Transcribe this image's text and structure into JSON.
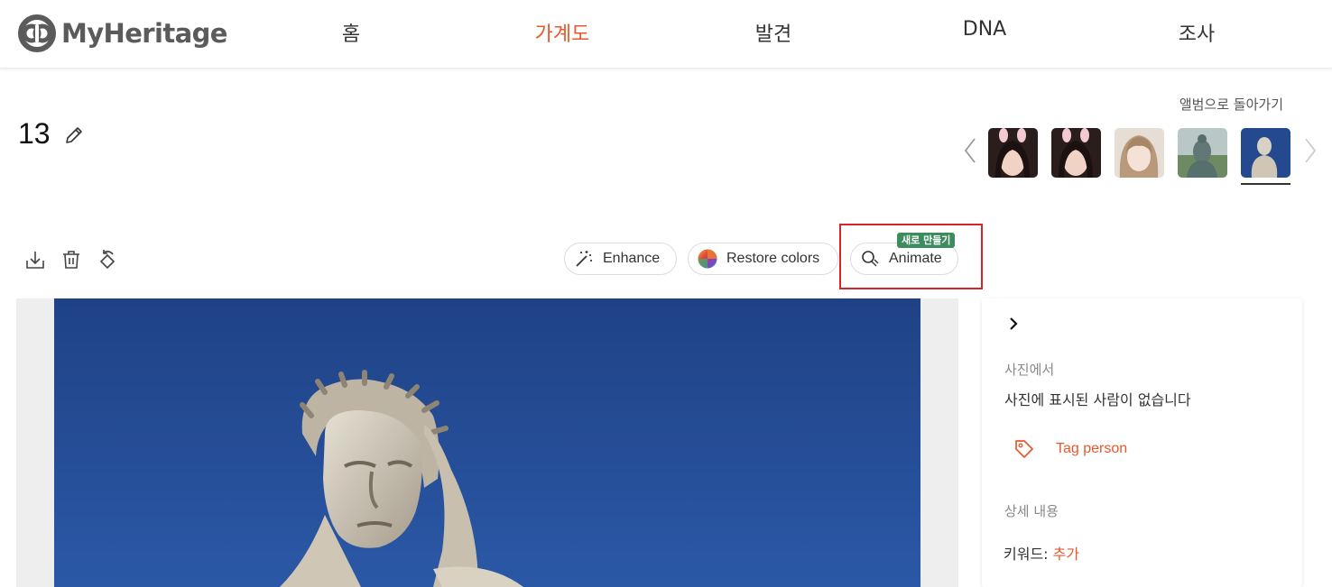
{
  "header": {
    "logo_text": "MyHeritage",
    "nav": [
      {
        "label": "홈",
        "active": false
      },
      {
        "label": "가계도",
        "active": true
      },
      {
        "label": "발견",
        "active": false
      },
      {
        "label": "DNA",
        "active": false
      },
      {
        "label": "조사",
        "active": false
      }
    ]
  },
  "album": {
    "back_label": "앨범으로 돌아가기",
    "thumbnails": [
      {
        "name": "thumb-photo-1",
        "selected": false
      },
      {
        "name": "thumb-photo-2",
        "selected": false
      },
      {
        "name": "thumb-photo-3",
        "selected": false
      },
      {
        "name": "thumb-photo-4",
        "selected": false
      },
      {
        "name": "thumb-photo-5",
        "selected": true
      }
    ]
  },
  "photo": {
    "title": "13"
  },
  "toolbar": {
    "icons": [
      "download-icon",
      "trash-icon",
      "rotate-icon"
    ],
    "enhance_label": "Enhance",
    "restore_label": "Restore colors",
    "animate_label": "Animate",
    "new_badge": "새로 만들기"
  },
  "panel": {
    "in_photo_label": "사진에서",
    "no_people_text": "사진에 표시된 사람이 없습니다",
    "tag_person_label": "Tag person",
    "details_label": "상세 내용",
    "keywords_label": "키워드:",
    "keywords_add": "추가"
  },
  "colors": {
    "accent": "#e8592c",
    "highlight": "#d6242c",
    "badge": "#3c8c5e",
    "sky": "#23498f"
  }
}
